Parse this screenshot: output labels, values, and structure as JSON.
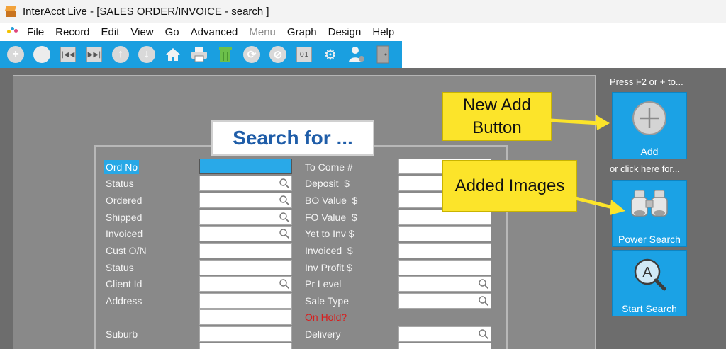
{
  "window": {
    "title": "InterAcct Live - [SALES ORDER/INVOICE - search ]"
  },
  "menu": [
    {
      "label": "File",
      "disabled": false
    },
    {
      "label": "Record",
      "disabled": false
    },
    {
      "label": "Edit",
      "disabled": false
    },
    {
      "label": "View",
      "disabled": false
    },
    {
      "label": "Go",
      "disabled": false
    },
    {
      "label": "Advanced",
      "disabled": false
    },
    {
      "label": "Menu",
      "disabled": true
    },
    {
      "label": "Graph",
      "disabled": false
    },
    {
      "label": "Design",
      "disabled": false
    },
    {
      "label": "Help",
      "disabled": false
    }
  ],
  "toolbar": {
    "buttons": [
      "add-icon",
      "remove-icon",
      "first-record-icon",
      "last-record-icon",
      "up-icon",
      "down-icon",
      "home-icon",
      "print-icon",
      "trash-icon",
      "refresh-icon",
      "cancel-icon",
      "counter-icon",
      "settings-icon",
      "user-settings-icon",
      "exit-door-icon"
    ],
    "counter_text": "01"
  },
  "search_form": {
    "heading": "Search for ...",
    "left_fields": [
      {
        "label": "Ord No",
        "selected": true,
        "lookup": false
      },
      {
        "label": "Status",
        "lookup": true
      },
      {
        "label": "Ordered",
        "lookup": true
      },
      {
        "label": "Shipped",
        "lookup": true
      },
      {
        "label": "Invoiced",
        "lookup": true
      },
      {
        "label": "Cust O/N",
        "lookup": false
      },
      {
        "label": "Status",
        "lookup": false
      },
      {
        "label": "Client Id",
        "lookup": true
      },
      {
        "label": "Address",
        "lookup": false
      },
      {
        "label": "",
        "lookup": false
      },
      {
        "label": "Suburb",
        "lookup": false
      }
    ],
    "right_fields": [
      {
        "label": "To Come #",
        "lookup": false
      },
      {
        "label": "Deposit  $",
        "lookup": false
      },
      {
        "label": "BO Value  $",
        "lookup": false
      },
      {
        "label": "FO Value  $",
        "lookup": false
      },
      {
        "label": "Yet to Inv $",
        "lookup": false
      },
      {
        "label": "Invoiced  $",
        "lookup": false
      },
      {
        "label": "Inv Profit $",
        "lookup": false
      },
      {
        "label": "Pr Level",
        "lookup": true
      },
      {
        "label": "Sale Type",
        "lookup": true
      },
      {
        "label": "On Hold?",
        "lookup": false,
        "red": true,
        "no_field": true
      },
      {
        "label": "Delivery",
        "lookup": true
      }
    ]
  },
  "sidebar": {
    "hint_top": "Press F2 or + to...",
    "hint_mid": "or click here for...",
    "add_label": "Add",
    "power_search_label": "Power Search",
    "start_search_label": "Start Search"
  },
  "callouts": {
    "new_add": "New Add Button",
    "added_images": "Added Images"
  },
  "colors": {
    "toolbar_blue": "#1a9fe0",
    "button_blue": "#1ba2e5",
    "callout_yellow": "#fce42a",
    "heading_blue": "#1f5da8",
    "on_hold_red": "#d81e1e"
  }
}
